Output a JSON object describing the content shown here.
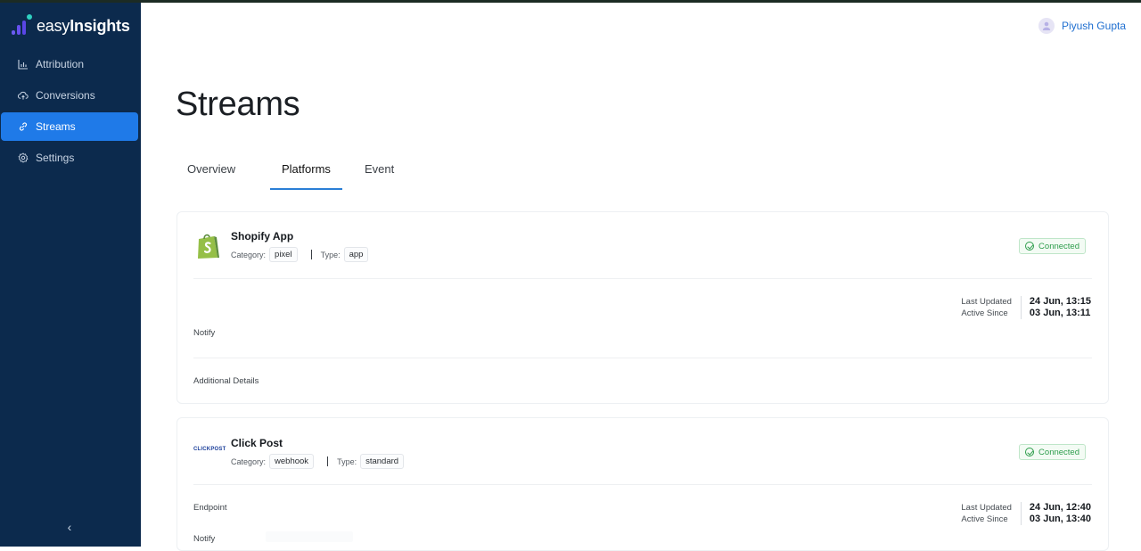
{
  "app": {
    "brand_light": "easy",
    "brand_bold": "Insights",
    "accent_color": "#1f7ae8",
    "sidebar_color": "#0c2a4d"
  },
  "sidebar": {
    "items": [
      {
        "label": "Attribution",
        "icon": "bar-chart-icon"
      },
      {
        "label": "Conversions",
        "icon": "cloud-upload-icon"
      },
      {
        "label": "Streams",
        "icon": "link-icon",
        "active": true
      },
      {
        "label": "Settings",
        "icon": "gear-icon"
      }
    ],
    "collapse_glyph": "‹"
  },
  "header": {
    "user_name": "Piyush Gupta"
  },
  "page": {
    "title": "Streams",
    "tabs": [
      {
        "label": "Overview"
      },
      {
        "label": "Platforms",
        "active": true
      },
      {
        "label": "Event"
      }
    ]
  },
  "platforms": [
    {
      "name": "Shopify App",
      "category_label": "Category:",
      "category": "pixel",
      "type_label": "Type:",
      "type": "app",
      "status": "Connected",
      "last_updated_label": "Last Updated",
      "last_updated": "24 Jun, 13:15",
      "active_since_label": "Active Since",
      "active_since": "03 Jun, 13:11",
      "field_notify": "Notify",
      "field_additional": "Additional Details"
    },
    {
      "name": "Click Post",
      "logo_text": "CLICKPOST",
      "category_label": "Category:",
      "category": "webhook",
      "type_label": "Type:",
      "type": "standard",
      "status": "Connected",
      "last_updated_label": "Last Updated",
      "last_updated": "24 Jun, 12:40",
      "active_since_label": "Active Since",
      "active_since": "03 Jun, 13:40",
      "field_endpoint": "Endpoint",
      "field_notify": "Notify"
    }
  ]
}
